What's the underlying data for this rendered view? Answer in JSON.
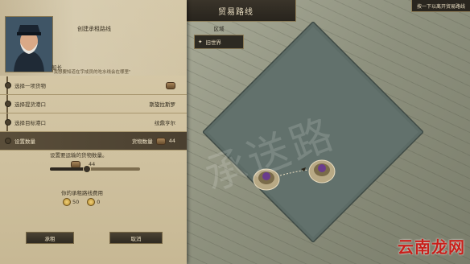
{
  "window": {
    "title": "贸易路线",
    "hint": "按一下以离开贸易路线"
  },
  "region": {
    "title": "区域",
    "selected": "旧世界"
  },
  "panel": {
    "title": "创建承租路线",
    "captain_label": "船长",
    "quote": "\"我想要知道在宇成员的吃水线会在哪里\""
  },
  "rows": [
    {
      "label": "选择一项货物",
      "value": ""
    },
    {
      "label": "选择提货港口",
      "value": "斯旋拉斯罗"
    },
    {
      "label": "选择目标港口",
      "value": "纹鼎亨尔"
    },
    {
      "label": "设置数量",
      "value_label": "货物数量",
      "value": "44"
    }
  ],
  "amount": {
    "label": "设置要运输的货物数量。",
    "value": "44",
    "fraction": 0.4
  },
  "cost": {
    "label": "你的承租路线费用",
    "coins": "50",
    "influence": "0"
  },
  "buttons": {
    "confirm": "承租",
    "cancel": "取消"
  },
  "watermark": {
    "text": "云南龙网"
  },
  "colors": {
    "panel": "#d3c5a3",
    "ocean": "#61706a",
    "dark_button": "#3a3328",
    "accent": "#7a6a48"
  },
  "icons": [
    "barrel-icon",
    "coin-icon",
    "influence-icon",
    "island-icon",
    "ship-icon",
    "region-crest-icon"
  ]
}
